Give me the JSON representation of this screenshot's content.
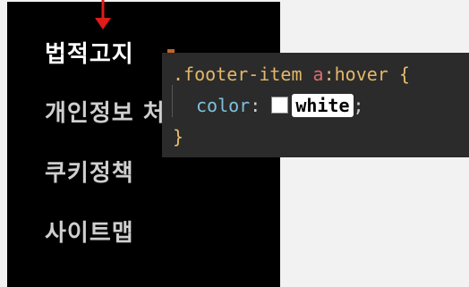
{
  "footer": {
    "items": [
      {
        "label": "법적고지"
      },
      {
        "label": "개인정보 처"
      },
      {
        "label": "쿠키정책"
      },
      {
        "label": "사이트맵"
      }
    ]
  },
  "code": {
    "selector_class": ".footer-item ",
    "selector_tag": "a",
    "selector_pseudo": ":hover",
    "open_brace": " {",
    "property": "color",
    "colon": ": ",
    "value": "white",
    "semicolon": ";",
    "close_brace": "}",
    "swatch_color": "#ffffff"
  },
  "annotation": {
    "arrow_color": "#e01b1b"
  }
}
